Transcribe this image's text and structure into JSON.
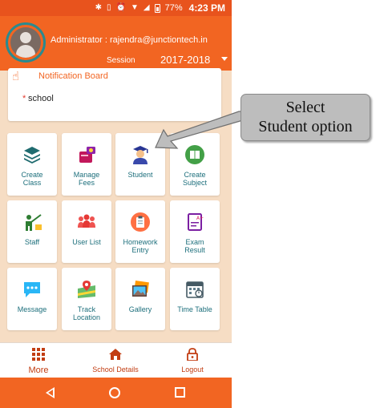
{
  "status_bar": {
    "battery": "77%",
    "time": "4:23 PM"
  },
  "header": {
    "admin_text": "Administrator : rajendra@junctiontech.in",
    "session_label": "Session",
    "session_value": "2017-2018"
  },
  "notice_board": {
    "title": "Notification Board",
    "items": [
      "school"
    ]
  },
  "tiles": [
    {
      "label": "Create\nClass",
      "icon": "layers-icon"
    },
    {
      "label": "Manage\nFees",
      "icon": "fees-icon"
    },
    {
      "label": "Student",
      "icon": "student-icon"
    },
    {
      "label": "Create\nSubject",
      "icon": "book-icon"
    },
    {
      "label": "Staff",
      "icon": "teacher-icon"
    },
    {
      "label": "User List",
      "icon": "users-icon"
    },
    {
      "label": "Homework\nEntry",
      "icon": "clipboard-icon"
    },
    {
      "label": "Exam\nResult",
      "icon": "exam-icon"
    },
    {
      "label": "Message",
      "icon": "chat-icon"
    },
    {
      "label": "Track\nLocation",
      "icon": "map-icon"
    },
    {
      "label": "Gallery",
      "icon": "gallery-icon"
    },
    {
      "label": "Time Table",
      "icon": "calendar-icon"
    }
  ],
  "bottom_nav": {
    "more": "More",
    "school_details": "School Details",
    "logout": "Logout"
  },
  "callout": {
    "line1": "Select",
    "line2": "Student option"
  },
  "colors": {
    "primary": "#f26522",
    "status": "#e8531d",
    "background": "#f6ddc4",
    "tile_text": "#1d6f7c"
  }
}
